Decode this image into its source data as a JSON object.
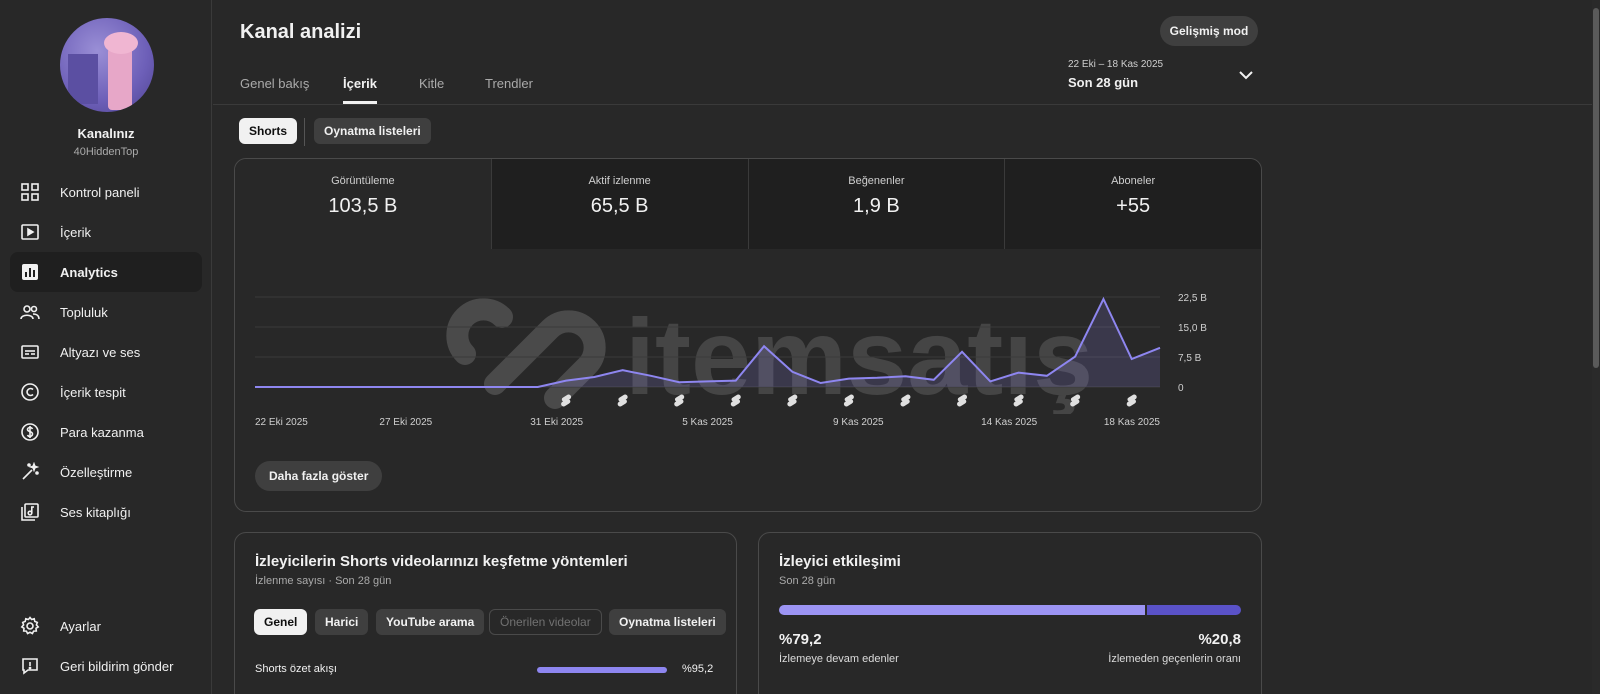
{
  "sidebar": {
    "channel_name": "Kanalınız",
    "channel_handle": "40HiddenTop",
    "items": [
      {
        "label": "Kontrol paneli",
        "icon": "dashboard-icon"
      },
      {
        "label": "İçerik",
        "icon": "content-icon"
      },
      {
        "label": "Analytics",
        "icon": "analytics-icon",
        "active": true
      },
      {
        "label": "Topluluk",
        "icon": "community-icon"
      },
      {
        "label": "Altyazı ve ses",
        "icon": "subtitles-icon"
      },
      {
        "label": "İçerik tespit",
        "icon": "copyright-icon"
      },
      {
        "label": "Para kazanma",
        "icon": "monetization-icon"
      },
      {
        "label": "Özelleştirme",
        "icon": "customization-icon"
      },
      {
        "label": "Ses kitaplığı",
        "icon": "audio-library-icon"
      }
    ],
    "bottom_items": [
      {
        "label": "Ayarlar",
        "icon": "settings-icon"
      },
      {
        "label": "Geri bildirim gönder",
        "icon": "feedback-icon"
      }
    ]
  },
  "header": {
    "title": "Kanal analizi",
    "advanced_mode": "Gelişmiş mod",
    "tabs": [
      "Genel bakış",
      "İçerik",
      "Kitle",
      "Trendler"
    ],
    "active_tab": "İçerik",
    "date_range": "22 Eki – 18 Kas 2025",
    "date_label": "Son 28 gün"
  },
  "filters": {
    "chips": [
      "Shorts",
      "Oynatma listeleri"
    ],
    "selected": "Shorts"
  },
  "metrics": [
    {
      "label": "Görüntüleme",
      "value": "103,5 B",
      "active": true
    },
    {
      "label": "Aktif izlenme",
      "value": "65,5 B"
    },
    {
      "label": "Beğenenler",
      "value": "1,9 B"
    },
    {
      "label": "Aboneler",
      "value": "+55"
    }
  ],
  "chart_data": {
    "type": "area",
    "x_labels": [
      "22 Eki 2025",
      "27 Eki 2025",
      "31 Eki 2025",
      "5 Kas 2025",
      "9 Kas 2025",
      "14 Kas 2025",
      "18 Kas 2025"
    ],
    "y_ticks": [
      "0",
      "7,5 B",
      "15,0 B",
      "22,5 B"
    ],
    "ylim": [
      0,
      22500
    ],
    "values": [
      0,
      0,
      0,
      0,
      0,
      0,
      0,
      0,
      0,
      0,
      0,
      1600,
      2500,
      4200,
      2800,
      1200,
      1400,
      1600,
      10200,
      3800,
      1000,
      2100,
      2300,
      2700,
      1800,
      8800,
      1400,
      3600,
      2800,
      7600,
      22000,
      7000,
      9800
    ],
    "color": "#8e86f0",
    "watermark": "itemsatış"
  },
  "actions": {
    "show_more": "Daha fazla göster"
  },
  "discovery": {
    "title": "İzleyicilerin Shorts videolarınızı keşfetme yöntemleri",
    "subtitle": "İzlenme sayısı · Son 28 gün",
    "chips": [
      "Genel",
      "Harici",
      "YouTube arama",
      "Önerilen videolar",
      "Oynatma listeleri"
    ],
    "rows": [
      {
        "label": "Shorts özet akışı",
        "value": "%95,2",
        "fraction": 0.952
      }
    ]
  },
  "engagement": {
    "title": "İzleyici etkileşimi",
    "subtitle": "Son 28 gün",
    "stay_value": "%79,2",
    "stay_label": "İzlemeye devam edenler",
    "swipe_value": "%20,8",
    "swipe_label": "İzlemeden geçenlerin oranı",
    "stay_fraction": 0.792
  }
}
